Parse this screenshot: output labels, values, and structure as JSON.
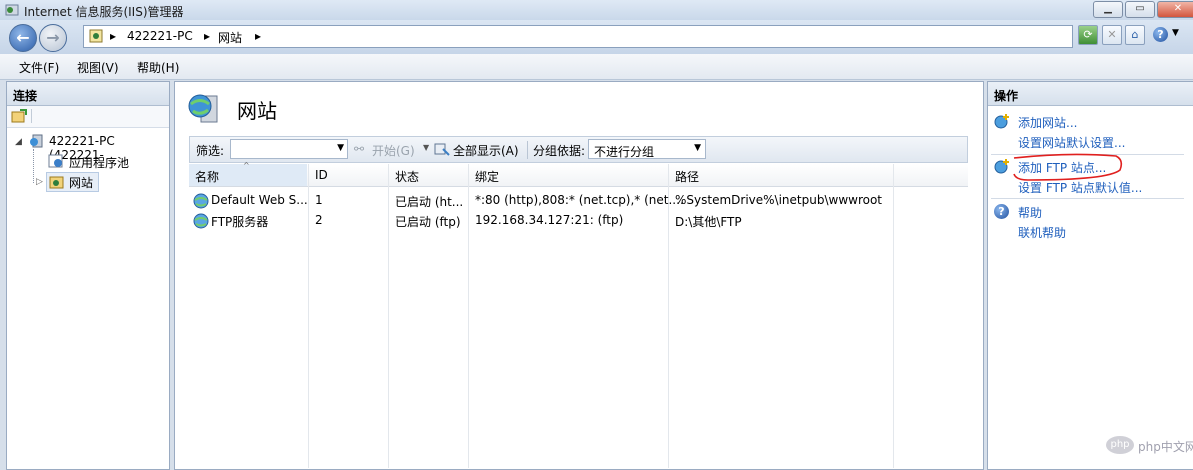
{
  "window": {
    "title": "Internet 信息服务(IIS)管理器"
  },
  "address": {
    "crumbs": [
      "422221-PC",
      "网站"
    ]
  },
  "menu": {
    "items": [
      "文件(F)",
      "视图(V)",
      "帮助(H)"
    ]
  },
  "left": {
    "header": "连接",
    "tree": {
      "root": "422221-PC (422221-",
      "app_pools": "应用程序池",
      "sites": "网站"
    }
  },
  "center": {
    "title": "网站",
    "filter": {
      "label": "筛选:",
      "value": "",
      "start": "开始(G)",
      "show_all": "全部显示(A)",
      "group_label": "分组依据:",
      "group_value": "不进行分组"
    },
    "columns": [
      "名称",
      "ID",
      "状态",
      "绑定",
      "路径"
    ],
    "rows": [
      {
        "name": "Default Web S...",
        "id": "1",
        "status": "已启动 (ht...",
        "binding": "*:80 (http),808:* (net.tcp),* (net....",
        "path": "%SystemDrive%\\inetpub\\wwwroot"
      },
      {
        "name": "FTP服务器",
        "id": "2",
        "status": "已启动 (ftp)",
        "binding": "192.168.34.127:21: (ftp)",
        "path": "D:\\其他\\FTP"
      }
    ]
  },
  "right": {
    "header": "操作",
    "actions": {
      "add_site": "添加网站...",
      "site_defaults": "设置网站默认设置...",
      "add_ftp": "添加 FTP 站点...",
      "ftp_defaults": "设置 FTP 站点默认值...",
      "help": "帮助",
      "online_help": "联机帮助"
    }
  },
  "watermark": "php中文网",
  "colors": {
    "link": "#1f5fbd",
    "annotation": "#e0201f"
  }
}
